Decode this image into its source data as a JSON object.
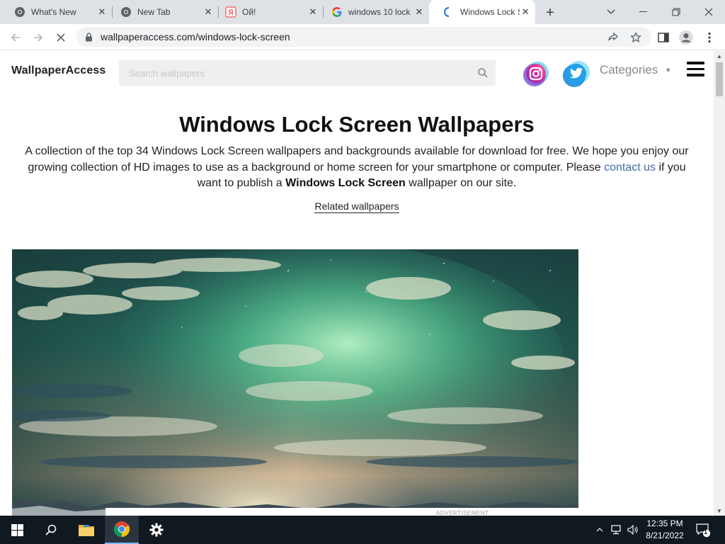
{
  "browser": {
    "tabs": [
      {
        "title": "What's New",
        "icon": "chrome-icon"
      },
      {
        "title": "New Tab",
        "icon": "chrome-icon"
      },
      {
        "title": "Ой!",
        "icon": "yandex-icon"
      },
      {
        "title": "windows 10 lock",
        "icon": "google-icon"
      },
      {
        "title": "Windows Lock S",
        "icon": "loading-spinner-icon"
      }
    ],
    "url": "wallpaperaccess.com/windows-lock-screen"
  },
  "site": {
    "logo": "WallpaperAccess",
    "search_placeholder": "Search wallpapers",
    "categories_label": "Categories",
    "title": "Windows Lock Screen Wallpapers",
    "desc_part1": "A collection of the top 34 Windows Lock Screen wallpapers and backgrounds available for download for free. We hope you enjoy our growing collection of HD images to use as a background or home screen for your smartphone or computer. Please ",
    "desc_link": "contact us",
    "desc_part2": " if you want to publish a ",
    "desc_bold": "Windows Lock Screen",
    "desc_part3": " wallpaper on our site.",
    "related_label": "Related wallpapers",
    "ad_label": "ADVERTISEMENT"
  },
  "taskbar": {
    "time": "12:35 PM",
    "date": "8/21/2022",
    "notification_count": "1"
  },
  "colors": {
    "link": "#3d6ea5",
    "taskbar": "#101820",
    "tabstrip": "#dee1e6"
  }
}
